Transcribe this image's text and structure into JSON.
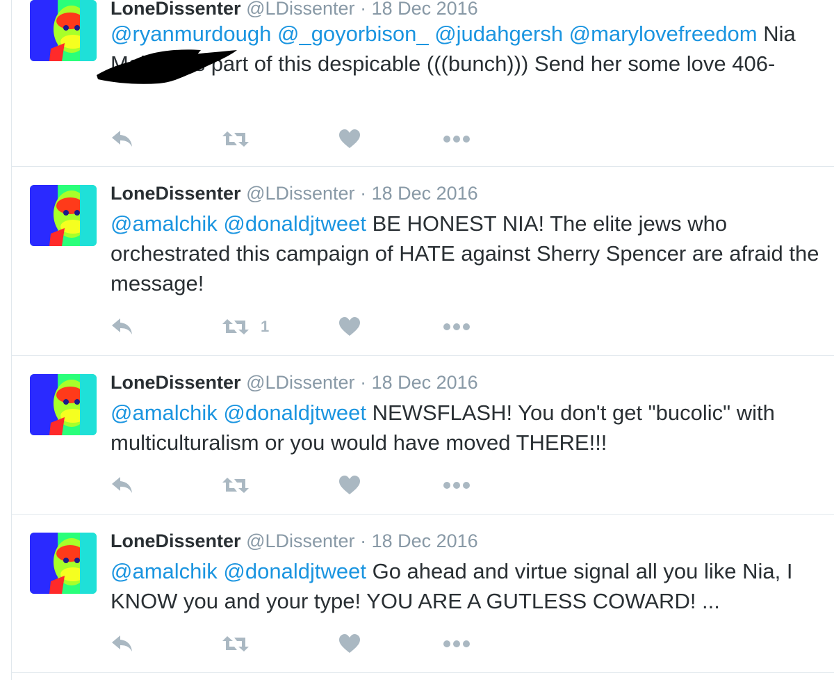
{
  "tweets": [
    {
      "name": "LoneDissenter",
      "handle": "@LDissenter",
      "separator": "·",
      "date": "18 Dec 2016",
      "mentions": "@ryanmurdough @_goyorbison_ @judahgersh @marylovefreedom",
      "text": "Nia Malchik is part of this despicable (((bunch))) Send her some love 406-",
      "retweet_count": ""
    },
    {
      "name": "LoneDissenter",
      "handle": "@LDissenter",
      "separator": "·",
      "date": "18 Dec 2016",
      "mentions": "@amalchik @donaldjtweet",
      "text": "BE HONEST NIA! The elite jews who orchestrated this campaign of HATE against Sherry Spencer are afraid the message!",
      "retweet_count": "1"
    },
    {
      "name": "LoneDissenter",
      "handle": "@LDissenter",
      "separator": "·",
      "date": "18 Dec 2016",
      "mentions": "@amalchik @donaldjtweet",
      "text": "NEWSFLASH! You don't get \"bucolic\" with multiculturalism or you would have moved THERE!!!",
      "retweet_count": ""
    },
    {
      "name": "LoneDissenter",
      "handle": "@LDissenter",
      "separator": "·",
      "date": "18 Dec 2016",
      "mentions": "@amalchik @donaldjtweet",
      "text": "Go ahead and virtue signal all you like Nia, I KNOW you and your type! YOU ARE A GUTLESS COWARD! ...",
      "retweet_count": ""
    }
  ],
  "icons": {
    "reply": "reply-icon",
    "retweet": "retweet-icon",
    "like": "heart-icon",
    "more": "more-icon"
  },
  "colors": {
    "link": "#1b95e0",
    "text": "#292f33",
    "muted": "#8899a6",
    "icon": "#aab8c2",
    "divider": "#e1e8ed"
  }
}
